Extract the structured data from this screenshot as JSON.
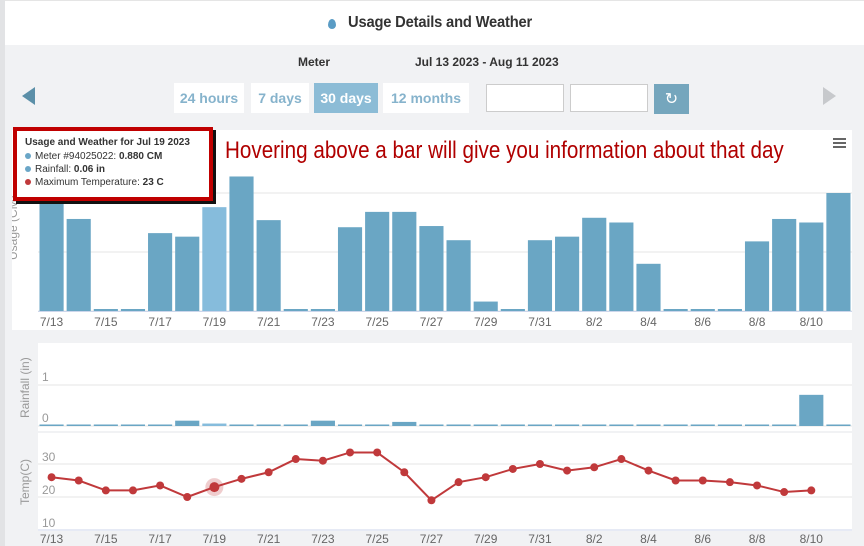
{
  "header": {
    "title": "Usage Details and Weather",
    "icon": "water-drop-icon"
  },
  "meter_row": {
    "meter_label": "Meter",
    "date_range": "Jul 13 2023 - Aug 11 2023"
  },
  "range_buttons": [
    {
      "label": "24 hours",
      "active": false
    },
    {
      "label": "7 days",
      "active": false
    },
    {
      "label": "30 days",
      "active": true
    },
    {
      "label": "12 months",
      "active": false
    }
  ],
  "date_inputs": {
    "start_value": "",
    "end_value": ""
  },
  "tooltip": {
    "title": "Usage and Weather for Jul 19 2023",
    "rows": [
      {
        "label": "Meter #94025022: ",
        "value": "0.880 CM",
        "color": "#6aa6c7"
      },
      {
        "label": "Rainfall: ",
        "value": "0.06 in",
        "color": "#6aa6c7"
      },
      {
        "label": "Maximum Temperature: ",
        "value": "23 C",
        "color": "#c0393b"
      }
    ]
  },
  "annotation": "Hovering above a bar will give you information about that day",
  "colors": {
    "bar": "#6aa6c4",
    "bar_highlight": "#86bcdc",
    "temp_line": "#c0393b",
    "grid": "#e6e6e6",
    "annotation": "#b00000"
  },
  "chart_data": [
    {
      "type": "bar",
      "title": "Usage",
      "ylabel": "Usage (CM)",
      "ylim": [
        0,
        1.0
      ],
      "yticks": [
        "0",
        "0.5"
      ],
      "categories": [
        "7/13",
        "7/14",
        "7/15",
        "7/16",
        "7/17",
        "7/18",
        "7/19",
        "7/20",
        "7/21",
        "7/22",
        "7/23",
        "7/24",
        "7/25",
        "7/26",
        "7/27",
        "7/28",
        "7/29",
        "7/30",
        "7/31",
        "8/1",
        "8/2",
        "8/3",
        "8/4",
        "8/5",
        "8/6",
        "8/7",
        "8/8",
        "8/9",
        "8/10",
        "8/11"
      ],
      "tick_labels": [
        "7/13",
        "7/15",
        "7/17",
        "7/19",
        "7/21",
        "7/23",
        "7/25",
        "7/27",
        "7/29",
        "7/31",
        "8/2",
        "8/4",
        "8/6",
        "8/8",
        "8/10"
      ],
      "values": [
        0.92,
        0.78,
        0.01,
        0.01,
        0.66,
        0.63,
        0.88,
        1.14,
        0.77,
        0.01,
        0.01,
        0.71,
        0.84,
        0.84,
        0.72,
        0.6,
        0.08,
        0.01,
        0.6,
        0.63,
        0.79,
        0.75,
        0.4,
        0.01,
        0.01,
        0.01,
        0.59,
        0.78,
        0.75,
        1.0
      ],
      "highlighted": "7/19"
    },
    {
      "type": "bar",
      "title": "Rainfall",
      "ylabel": "Rainfall (in)",
      "ylim": [
        0,
        1.3
      ],
      "yticks": [
        "0",
        "1"
      ],
      "categories": [
        "7/13",
        "7/14",
        "7/15",
        "7/16",
        "7/17",
        "7/18",
        "7/19",
        "7/20",
        "7/21",
        "7/22",
        "7/23",
        "7/24",
        "7/25",
        "7/26",
        "7/27",
        "7/28",
        "7/29",
        "7/30",
        "7/31",
        "8/1",
        "8/2",
        "8/3",
        "8/4",
        "8/5",
        "8/6",
        "8/7",
        "8/8",
        "8/9",
        "8/10",
        "8/11"
      ],
      "values": [
        0,
        0,
        0,
        0,
        0,
        0.13,
        0.06,
        0,
        0,
        0,
        0.13,
        0,
        0,
        0.1,
        0,
        0,
        0,
        0,
        0,
        0,
        0,
        0,
        0,
        0,
        0,
        0,
        0,
        0,
        0.76,
        0
      ],
      "highlighted": "7/19"
    },
    {
      "type": "line",
      "title": "Temperature",
      "ylabel": "Temp(C)",
      "ylim": [
        10,
        30
      ],
      "yticks": [
        "10",
        "20",
        "30"
      ],
      "categories": [
        "7/13",
        "7/14",
        "7/15",
        "7/16",
        "7/17",
        "7/18",
        "7/19",
        "7/20",
        "7/21",
        "7/22",
        "7/23",
        "7/24",
        "7/25",
        "7/26",
        "7/27",
        "7/28",
        "7/29",
        "7/30",
        "7/31",
        "8/1",
        "8/2",
        "8/3",
        "8/4",
        "8/5",
        "8/6",
        "8/7",
        "8/8",
        "8/9",
        "8/10",
        "8/11"
      ],
      "tick_labels": [
        "7/13",
        "7/15",
        "7/17",
        "7/19",
        "7/21",
        "7/23",
        "7/25",
        "7/27",
        "7/29",
        "7/31",
        "8/2",
        "8/4",
        "8/6",
        "8/8",
        "8/10"
      ],
      "values": [
        26,
        25,
        22,
        22,
        23.5,
        20,
        23,
        25.5,
        27.5,
        31.5,
        31,
        33.5,
        33.5,
        27.5,
        19,
        24.5,
        26,
        28.5,
        30,
        28,
        29,
        31.5,
        28,
        25,
        25,
        24.5,
        23.5,
        21.5,
        22,
        null
      ],
      "highlighted": "7/19"
    }
  ]
}
